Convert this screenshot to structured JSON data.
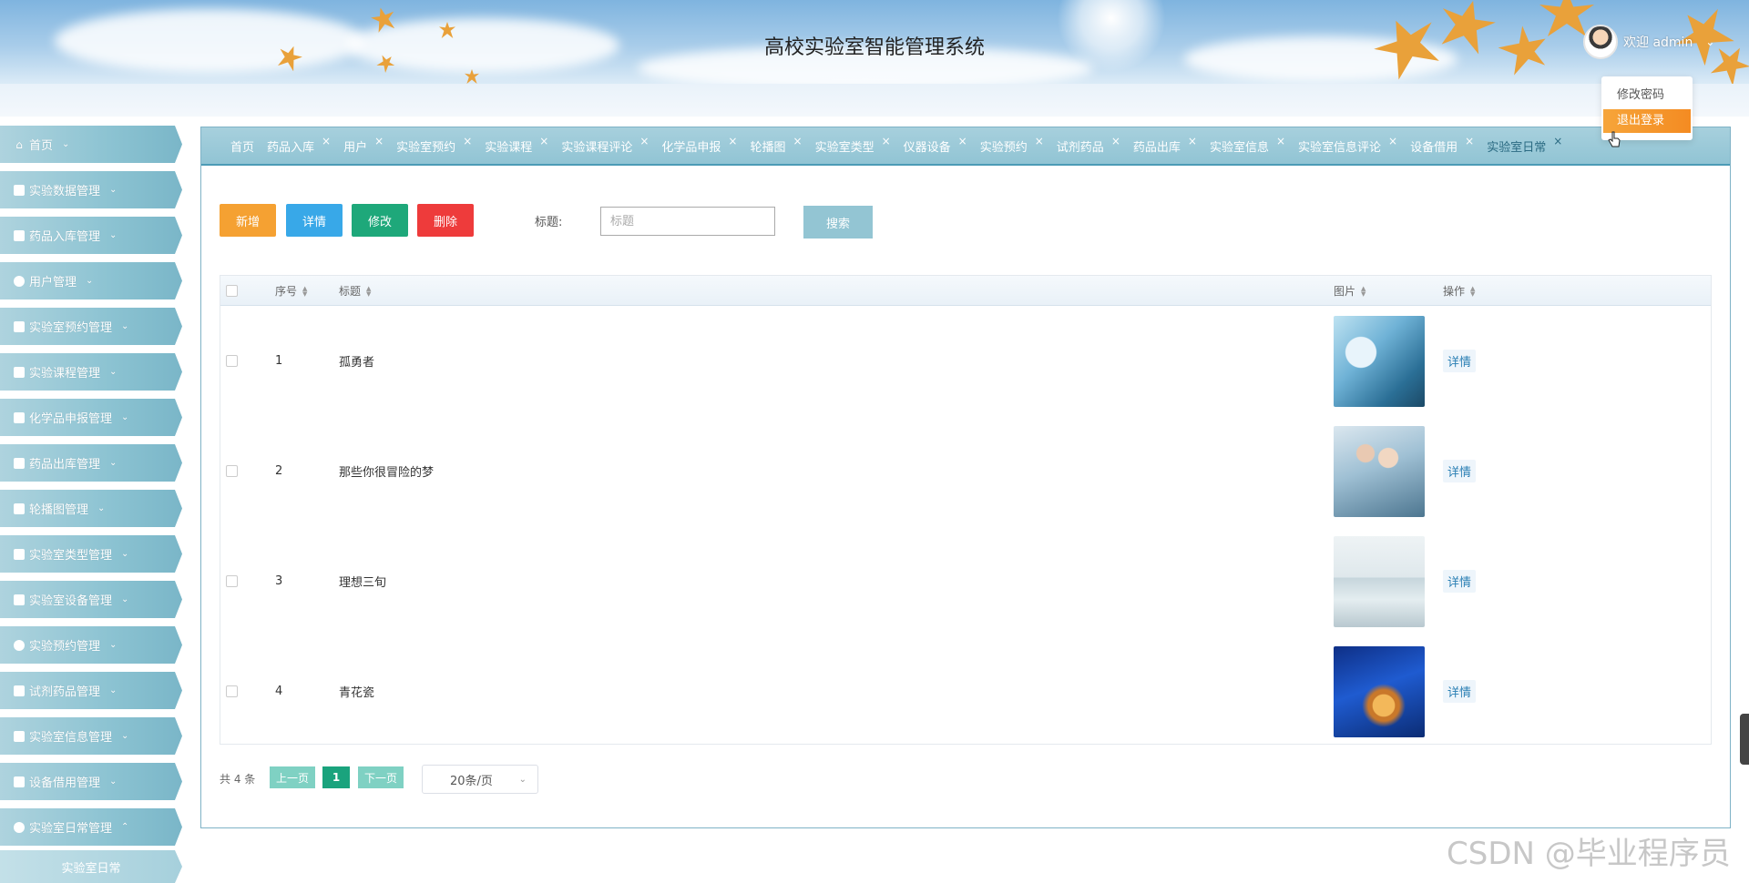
{
  "header": {
    "title": "高校实验室智能管理系统",
    "welcome": "欢迎 admin",
    "dropdown": {
      "change_password": "修改密码",
      "logout": "退出登录"
    }
  },
  "sidebar": {
    "items": [
      {
        "label": "首页",
        "icon": "home-icon"
      },
      {
        "label": "实验数据管理",
        "icon": "document-icon"
      },
      {
        "label": "药品入库管理",
        "icon": "store-icon"
      },
      {
        "label": "用户管理",
        "icon": "user-icon"
      },
      {
        "label": "实验室预约管理",
        "icon": "grid-icon"
      },
      {
        "label": "实验课程管理",
        "icon": "list-icon"
      },
      {
        "label": "化学品申报管理",
        "icon": "table-icon"
      },
      {
        "label": "药品出库管理",
        "icon": "box-icon"
      },
      {
        "label": "轮播图管理",
        "icon": "briefcase-icon"
      },
      {
        "label": "实验室类型管理",
        "icon": "columns-icon"
      },
      {
        "label": "实验室设备管理",
        "icon": "server-icon"
      },
      {
        "label": "实验预约管理",
        "icon": "circle-icon"
      },
      {
        "label": "试剂药品管理",
        "icon": "gift-icon"
      },
      {
        "label": "实验室信息管理",
        "icon": "id-card-icon"
      },
      {
        "label": "设备借用管理",
        "icon": "crop-icon"
      },
      {
        "label": "实验室日常管理",
        "icon": "drop-icon"
      }
    ],
    "sub_item": "实验室日常"
  },
  "tabs": [
    {
      "label": "首页",
      "closable": false
    },
    {
      "label": "药品入库",
      "closable": true
    },
    {
      "label": "用户",
      "closable": true
    },
    {
      "label": "实验室预约",
      "closable": true
    },
    {
      "label": "实验课程",
      "closable": true
    },
    {
      "label": "实验课程评论",
      "closable": true
    },
    {
      "label": "化学品申报",
      "closable": true
    },
    {
      "label": "轮播图",
      "closable": true
    },
    {
      "label": "实验室类型",
      "closable": true
    },
    {
      "label": "仪器设备",
      "closable": true
    },
    {
      "label": "实验预约",
      "closable": true
    },
    {
      "label": "试剂药品",
      "closable": true
    },
    {
      "label": "药品出库",
      "closable": true
    },
    {
      "label": "实验室信息",
      "closable": true
    },
    {
      "label": "实验室信息评论",
      "closable": true
    },
    {
      "label": "设备借用",
      "closable": true
    },
    {
      "label": "实验室日常",
      "closable": true,
      "active": true
    }
  ],
  "toolbar": {
    "add": "新增",
    "detail": "详情",
    "edit": "修改",
    "delete": "删除",
    "search_label": "标题:",
    "search_placeholder": "标题",
    "search_value": "",
    "search_button": "搜索"
  },
  "table": {
    "columns": [
      "序号",
      "标题",
      "图片",
      "操作"
    ],
    "rows": [
      {
        "index": "1",
        "title": "孤勇者",
        "image": "lab-microscope",
        "action": "详情"
      },
      {
        "index": "2",
        "title": "那些你很冒险的梦",
        "image": "lab-scientists",
        "action": "详情"
      },
      {
        "index": "3",
        "title": "理想三旬",
        "image": "lab-room",
        "action": "详情"
      },
      {
        "index": "4",
        "title": "青花瓷",
        "image": "lab-glassware",
        "action": "详情"
      }
    ]
  },
  "pagination": {
    "total": "共 4 条",
    "prev": "上一页",
    "current": "1",
    "next": "下一页",
    "page_size": "20条/页"
  },
  "watermark": "CSDN @毕业程序员",
  "colors": {
    "add": "#f5a132",
    "detail": "#38a8e8",
    "edit": "#1ea87a",
    "delete": "#ee3b3b",
    "search": "#93c5d3",
    "pager_current": "#1aa37d",
    "logout_highlight": "#f48b22",
    "sidebar": "#8cc3d2"
  }
}
